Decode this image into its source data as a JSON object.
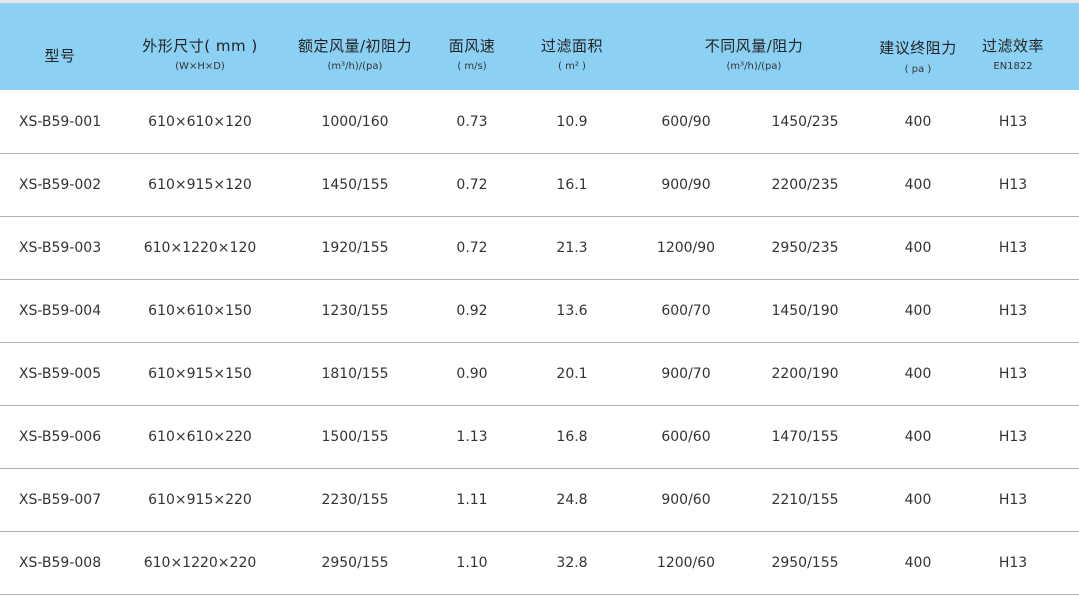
{
  "headers": {
    "model": "型号",
    "size": "外形尺寸( mm )",
    "size_sub": "(W×H×D)",
    "rated": "额定风量/初阻力",
    "rated_sub": "(m³/h)/(pa)",
    "velocity": "面风速",
    "velocity_sub": "( m/s)",
    "area": "过滤面积",
    "area_sub": "( m² )",
    "varied": "不同风量/阻力",
    "varied_sub": "(m³/h)/(pa)",
    "final": "建议终阻力",
    "final_sub": "( pa )",
    "efficiency": "过滤效率",
    "efficiency_sub": "EN1822"
  },
  "rows": [
    {
      "model": "XS-B59-001",
      "size": "610×610×120",
      "rated": "1000/160",
      "velocity": "0.73",
      "area": "10.9",
      "flow1": "600/90",
      "flow2": "1450/235",
      "final": "400",
      "eff": "H13"
    },
    {
      "model": "XS-B59-002",
      "size": "610×915×120",
      "rated": "1450/155",
      "velocity": "0.72",
      "area": "16.1",
      "flow1": "900/90",
      "flow2": "2200/235",
      "final": "400",
      "eff": "H13"
    },
    {
      "model": "XS-B59-003",
      "size": "610×1220×120",
      "rated": "1920/155",
      "velocity": "0.72",
      "area": "21.3",
      "flow1": "1200/90",
      "flow2": "2950/235",
      "final": "400",
      "eff": "H13"
    },
    {
      "model": "XS-B59-004",
      "size": "610×610×150",
      "rated": "1230/155",
      "velocity": "0.92",
      "area": "13.6",
      "flow1": "600/70",
      "flow2": "1450/190",
      "final": "400",
      "eff": "H13"
    },
    {
      "model": "XS-B59-005",
      "size": "610×915×150",
      "rated": "1810/155",
      "velocity": "0.90",
      "area": "20.1",
      "flow1": "900/70",
      "flow2": "2200/190",
      "final": "400",
      "eff": "H13"
    },
    {
      "model": "XS-B59-006",
      "size": "610×610×220",
      "rated": "1500/155",
      "velocity": "1.13",
      "area": "16.8",
      "flow1": "600/60",
      "flow2": "1470/155",
      "final": "400",
      "eff": "H13"
    },
    {
      "model": "XS-B59-007",
      "size": "610×915×220",
      "rated": "2230/155",
      "velocity": "1.11",
      "area": "24.8",
      "flow1": "900/60",
      "flow2": "2210/155",
      "final": "400",
      "eff": "H13"
    },
    {
      "model": "XS-B59-008",
      "size": "610×1220×220",
      "rated": "2950/155",
      "velocity": "1.10",
      "area": "32.8",
      "flow1": "1200/60",
      "flow2": "2950/155",
      "final": "400",
      "eff": "H13"
    }
  ]
}
